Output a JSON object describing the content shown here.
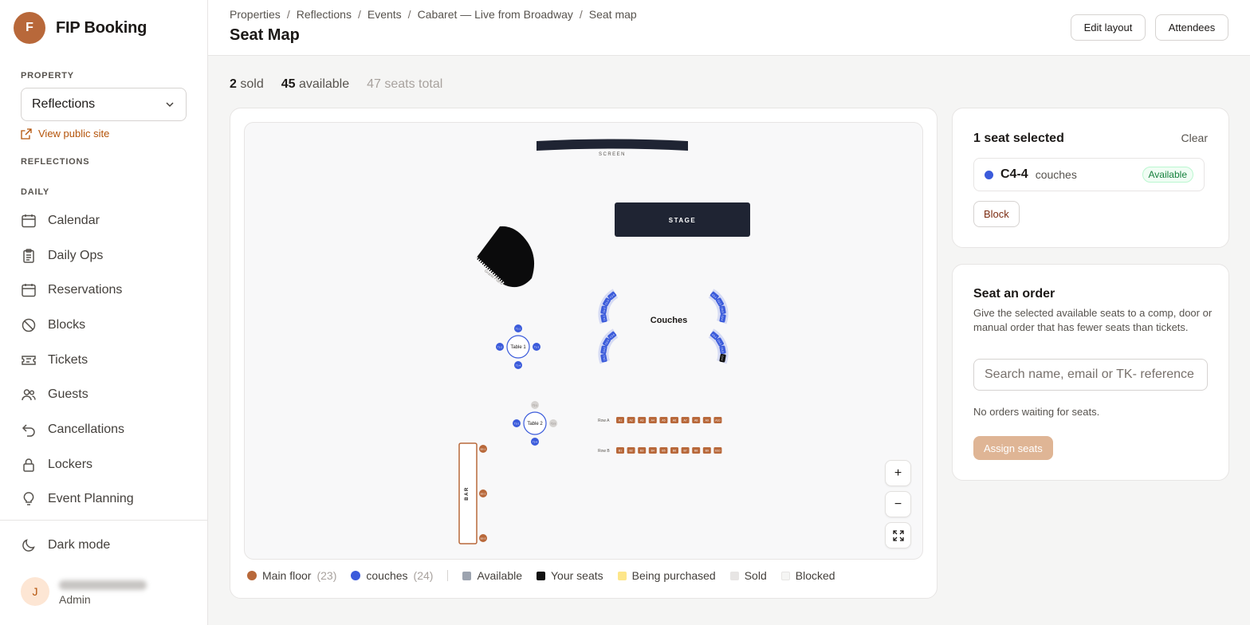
{
  "brand": {
    "initial": "F",
    "name": "FIP Booking"
  },
  "sidebar": {
    "property_label": "PROPERTY",
    "property_value": "Reflections",
    "public_link": "View public site",
    "org_label": "REFLECTIONS",
    "group_label": "DAILY",
    "items": [
      {
        "label": "Calendar",
        "icon": "calendar-icon"
      },
      {
        "label": "Daily Ops",
        "icon": "clipboard-icon"
      },
      {
        "label": "Reservations",
        "icon": "calendar-icon"
      },
      {
        "label": "Blocks",
        "icon": "ban-icon"
      },
      {
        "label": "Tickets",
        "icon": "ticket-icon"
      },
      {
        "label": "Guests",
        "icon": "users-icon"
      },
      {
        "label": "Cancellations",
        "icon": "undo-icon"
      },
      {
        "label": "Lockers",
        "icon": "lock-icon"
      },
      {
        "label": "Event Planning",
        "icon": "lightbulb-icon"
      }
    ],
    "dark_mode": "Dark mode",
    "user": {
      "initial": "J",
      "role": "Admin"
    }
  },
  "header": {
    "breadcrumbs": [
      "Properties",
      "Reflections",
      "Events",
      "Cabaret — Live from Broadway",
      "Seat map"
    ],
    "separator": "/",
    "title": "Seat Map",
    "edit_layout": "Edit layout",
    "attendees": "Attendees"
  },
  "stats": {
    "sold": "2",
    "sold_label": "sold",
    "available": "45",
    "available_label": "available",
    "total": "47 seats total"
  },
  "map": {
    "screen_label": "SCREEN",
    "stage_label": "STAGE",
    "piano_label": "Grand Piano",
    "couches_label": "Couches",
    "bar_label": "BAR",
    "table1_label": "Table 1",
    "table2_label": "Table 2",
    "row_a_label": "Row A",
    "row_b_label": "Row B",
    "row_a_seats": [
      "A1",
      "A2",
      "A3",
      "A4",
      "A5",
      "A6",
      "A7",
      "A8",
      "A9",
      "A10"
    ],
    "row_b_seats": [
      "B1",
      "B2",
      "B3",
      "B4",
      "B5",
      "B6",
      "B7",
      "B8",
      "B9",
      "B10"
    ],
    "couch_groups": [
      {
        "name": "C1",
        "seats": [
          "C1-1",
          "C1-2",
          "C1-3",
          "C1-4"
        ]
      },
      {
        "name": "C2",
        "seats": [
          "C2-1",
          "C2-2",
          "C2-3",
          "C2-4"
        ]
      },
      {
        "name": "C3",
        "seats": [
          "C3-1",
          "C3-2",
          "C3-3",
          "C3-4"
        ]
      },
      {
        "name": "C4",
        "seats": [
          "C4-1",
          "C4-2",
          "C4-3",
          "C4-4"
        ]
      }
    ],
    "selected_seat": "C4-4",
    "zoom_in": "+",
    "zoom_out": "−"
  },
  "legend": [
    {
      "label": "Main floor",
      "count": "(23)",
      "color": "#b8683a"
    },
    {
      "label": "couches",
      "count": "(24)",
      "color": "#3b5bdb"
    },
    {
      "label": "Available",
      "color": "#a8a29e"
    },
    {
      "label": "Your seats",
      "color": "#111111"
    },
    {
      "label": "Being purchased",
      "color": "#fde68a"
    },
    {
      "label": "Sold",
      "color": "#e7e5e4"
    },
    {
      "label": "Blocked",
      "color": "#f5f5f4"
    }
  ],
  "selection": {
    "title": "1 seat selected",
    "clear": "Clear",
    "seat_id": "C4-4",
    "seat_zone": "couches",
    "status": "Available",
    "block": "Block"
  },
  "order": {
    "title": "Seat an order",
    "description": "Give the selected available seats to a comp, door or manual order that has fewer seats than tickets.",
    "search_placeholder": "Search name, email or TK- reference",
    "empty": "No orders waiting for seats.",
    "assign": "Assign seats"
  },
  "colors": {
    "accent": "#b8683a",
    "couch": "#3b5bdb",
    "stage": "#1f2433"
  }
}
